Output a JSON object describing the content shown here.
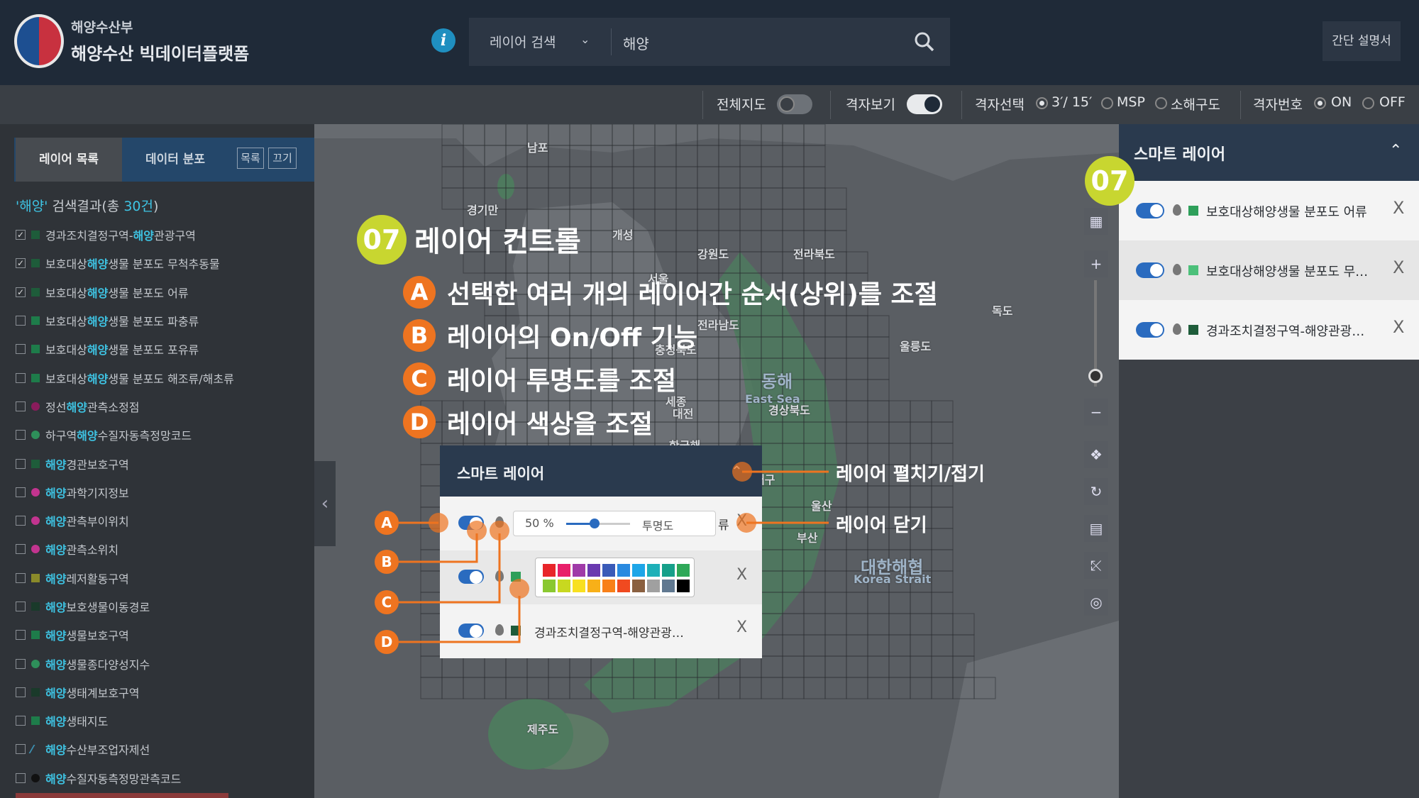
{
  "header": {
    "ministry": "해양수산부",
    "platform": "해양수산 빅데이터플랫폼",
    "info_icon": "i",
    "search_select": "레이어 검색",
    "search_value": "해양",
    "guide_button": "간단 설명서"
  },
  "toolbar": {
    "full_map": "전체지도",
    "grid_view": "격자보기",
    "grid_select": "격자선택",
    "grid_opt1": "3′/ 15′",
    "grid_opt2": "MSP",
    "grid_opt3": "소해구도",
    "grid_number": "격자번호",
    "on": "ON",
    "off": "OFF"
  },
  "left": {
    "tab_layers": "레이어 목록",
    "tab_dist": "데이터 분포",
    "btn_list": "목록",
    "btn_off": "끄기",
    "result_kw": "'해양'",
    "result_rest": " 검색결과(총 ",
    "result_count": "30건",
    "result_close": ")",
    "items": [
      {
        "pre": "경과조치결정구역-",
        "kw": "해양",
        "post": "관광구역",
        "checked": true,
        "color": "#1e5c3a",
        "shape": "sq"
      },
      {
        "pre": "보호대상",
        "kw": "해양",
        "post": "생물 분포도 무척추동물",
        "checked": true,
        "color": "#1e5c3a",
        "shape": "sq"
      },
      {
        "pre": "보호대상",
        "kw": "해양",
        "post": "생물 분포도 어류",
        "checked": true,
        "color": "#1e5c3a",
        "shape": "sq"
      },
      {
        "pre": "보호대상",
        "kw": "해양",
        "post": "생물 분포도 파충류",
        "checked": false,
        "color": "#1e7c4a",
        "shape": "sq"
      },
      {
        "pre": "보호대상",
        "kw": "해양",
        "post": "생물 분포도 포유류",
        "checked": false,
        "color": "#1e7c4a",
        "shape": "sq"
      },
      {
        "pre": "보호대상",
        "kw": "해양",
        "post": "생물 분포도 해조류/해초류",
        "checked": false,
        "color": "#1e7c4a",
        "shape": "sq"
      },
      {
        "pre": "정선",
        "kw": "해양",
        "post": "관측소정점",
        "checked": false,
        "color": "#8a1c5c",
        "shape": "circ"
      },
      {
        "pre": "하구역",
        "kw": "해양",
        "post": "수질자동측정망코드",
        "checked": false,
        "color": "#2e8f5a",
        "shape": "circ"
      },
      {
        "pre": "",
        "kw": "해양",
        "post": "경관보호구역",
        "checked": false,
        "color": "#1e5c3a",
        "shape": "sq"
      },
      {
        "pre": "",
        "kw": "해양",
        "post": "과학기지정보",
        "checked": false,
        "color": "#c2348f",
        "shape": "circ"
      },
      {
        "pre": "",
        "kw": "해양",
        "post": "관측부이위치",
        "checked": false,
        "color": "#c2348f",
        "shape": "circ"
      },
      {
        "pre": "",
        "kw": "해양",
        "post": "관측소위치",
        "checked": false,
        "color": "#c2348f",
        "shape": "circ"
      },
      {
        "pre": "",
        "kw": "해양",
        "post": "레저활동구역",
        "checked": false,
        "color": "#8a8a2a",
        "shape": "sq"
      },
      {
        "pre": "",
        "kw": "해양",
        "post": "보호생물이동경로",
        "checked": false,
        "color": "#1a3a2a",
        "shape": "sq"
      },
      {
        "pre": "",
        "kw": "해양",
        "post": "생물보호구역",
        "checked": false,
        "color": "#1e7c4a",
        "shape": "sq"
      },
      {
        "pre": "",
        "kw": "해양",
        "post": "생물종다양성지수",
        "checked": false,
        "color": "#2e8f5a",
        "shape": "circ"
      },
      {
        "pre": "",
        "kw": "해양",
        "post": "생태계보호구역",
        "checked": false,
        "color": "#1a3a2a",
        "shape": "sq"
      },
      {
        "pre": "",
        "kw": "해양",
        "post": "생태지도",
        "checked": false,
        "color": "#1e7c4a",
        "shape": "sq"
      },
      {
        "pre": "",
        "kw": "해양",
        "post": "수산부조업자제선",
        "checked": false,
        "color": "#3c8fb0",
        "shape": "line"
      },
      {
        "pre": "",
        "kw": "해양",
        "post": "수질자동측정망관측코드",
        "checked": false,
        "color": "#111111",
        "shape": "circ"
      }
    ]
  },
  "map": {
    "labels": [
      "남포",
      "개성",
      "서울",
      "강원도",
      "충청북도",
      "세종",
      "대전",
      "경상북도",
      "대구",
      "울산",
      "부산",
      "한국해",
      "동해",
      "East Sea",
      "대한해협",
      "Korea Strait",
      "독도",
      "울릉도",
      "전라북도",
      "경기만",
      "전라남도",
      "제주도"
    ]
  },
  "right": {
    "title": "스마트 레이어",
    "layers": [
      {
        "label": "보호대상해양생물 분포도 어류",
        "color": "#2e9f5a"
      },
      {
        "label": "보호대상해양생물 분포도 무…",
        "color": "#4cc07a"
      },
      {
        "label": "경과조치결정구역-해양관광…",
        "color": "#1e5c3a"
      }
    ],
    "close": "X"
  },
  "overlay": {
    "badge": "07",
    "title": "레이어 컨트롤",
    "items": [
      {
        "key": "A",
        "text": "선택한 여러 개의 레이어간 순서(상위)를 조절"
      },
      {
        "key": "B",
        "text": "레이어의 On/Off 기능"
      },
      {
        "key": "C",
        "text": "레이어 투명도를 조절"
      },
      {
        "key": "D",
        "text": "레이어 색상을 조절"
      }
    ],
    "inner_title": "스마트 레이어",
    "opacity_pct": "50 %",
    "opacity_label": "투명도",
    "opacity_value": 0.5,
    "row1_tail": "류",
    "row3_label": "경과조치결정구역-해양관광…",
    "callout_fold": "레이어 펼치기/접기",
    "callout_close": "레이어 닫기",
    "palette": [
      "#e8252a",
      "#e8206a",
      "#a03aa8",
      "#6a3ab0",
      "#3a5ab8",
      "#2a8ae0",
      "#1ea6e8",
      "#1eb0b8",
      "#16a08a",
      "#2ea858",
      "#8ac830",
      "#c8d820",
      "#f8e020",
      "#f8b018",
      "#f88018",
      "#f04a20",
      "#8a6040",
      "#a0a0a0",
      "#607890",
      "#000000"
    ]
  }
}
